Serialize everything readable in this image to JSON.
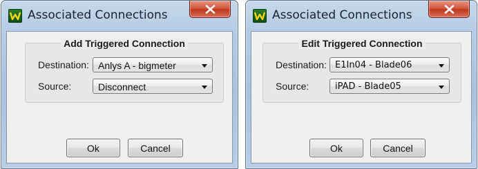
{
  "dialogs": [
    {
      "title": "Associated Connections",
      "group_title": "Add Triggered Connection",
      "destination": {
        "label": "Destination:",
        "value": "Anlys A - bigmeter"
      },
      "source": {
        "label": "Source:",
        "value": "Disconnect"
      },
      "ok_label": "Ok",
      "cancel_label": "Cancel"
    },
    {
      "title": "Associated Connections",
      "group_title": "Edit Triggered Connection",
      "destination": {
        "label": "Destination:",
        "value": "E1In04 - Blade06"
      },
      "source": {
        "label": "Source:",
        "value": "iPAD - Blade05"
      },
      "ok_label": "Ok",
      "cancel_label": "Cancel"
    }
  ],
  "icons": {
    "app": "app-w-logo-icon",
    "close": "close-icon",
    "dropdown": "chevron-down-icon"
  },
  "colors": {
    "app_icon_bg": "#1f6b22",
    "app_icon_mark": "#f2d51c",
    "close_button": "#c7442b"
  }
}
